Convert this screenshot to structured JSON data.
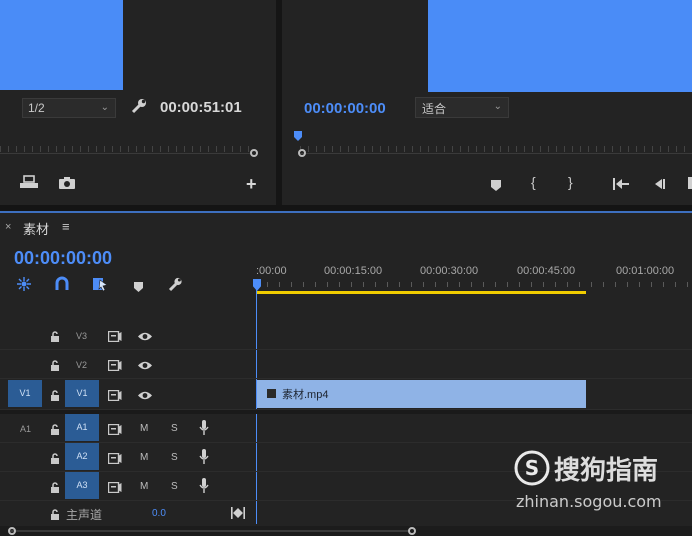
{
  "source_monitor": {
    "resolution": "1/2",
    "timecode": "00:00:51:01"
  },
  "program_monitor": {
    "timecode": "00:00:00:00",
    "fit": "适合"
  },
  "timeline": {
    "close": "×",
    "sequence_name": "素材",
    "menu": "≡",
    "timecode": "00:00:00:00",
    "ruler_labels": [
      ":00:00",
      "00:00:15:00",
      "00:00:30:00",
      "00:00:45:00",
      "00:01:00:00"
    ],
    "clip_name": "素材.mp4",
    "tracks": {
      "v3": "V3",
      "v2": "V2",
      "v1": "V1",
      "v1_src": "V1",
      "a1_src": "A1",
      "a1": "A1",
      "a2": "A2",
      "a3": "A3",
      "mute": "M",
      "solo": "S",
      "master": "主声道",
      "master_value": "0.0"
    }
  },
  "watermark": {
    "brand": "搜狗指南",
    "url": "zhinan.sogou.com"
  },
  "colors": {
    "preview_blue": "#4a8cf7",
    "accent_blue": "#4d8df8",
    "clip_blue": "#8fb3e6",
    "work_area_yellow": "#f0cc00"
  }
}
